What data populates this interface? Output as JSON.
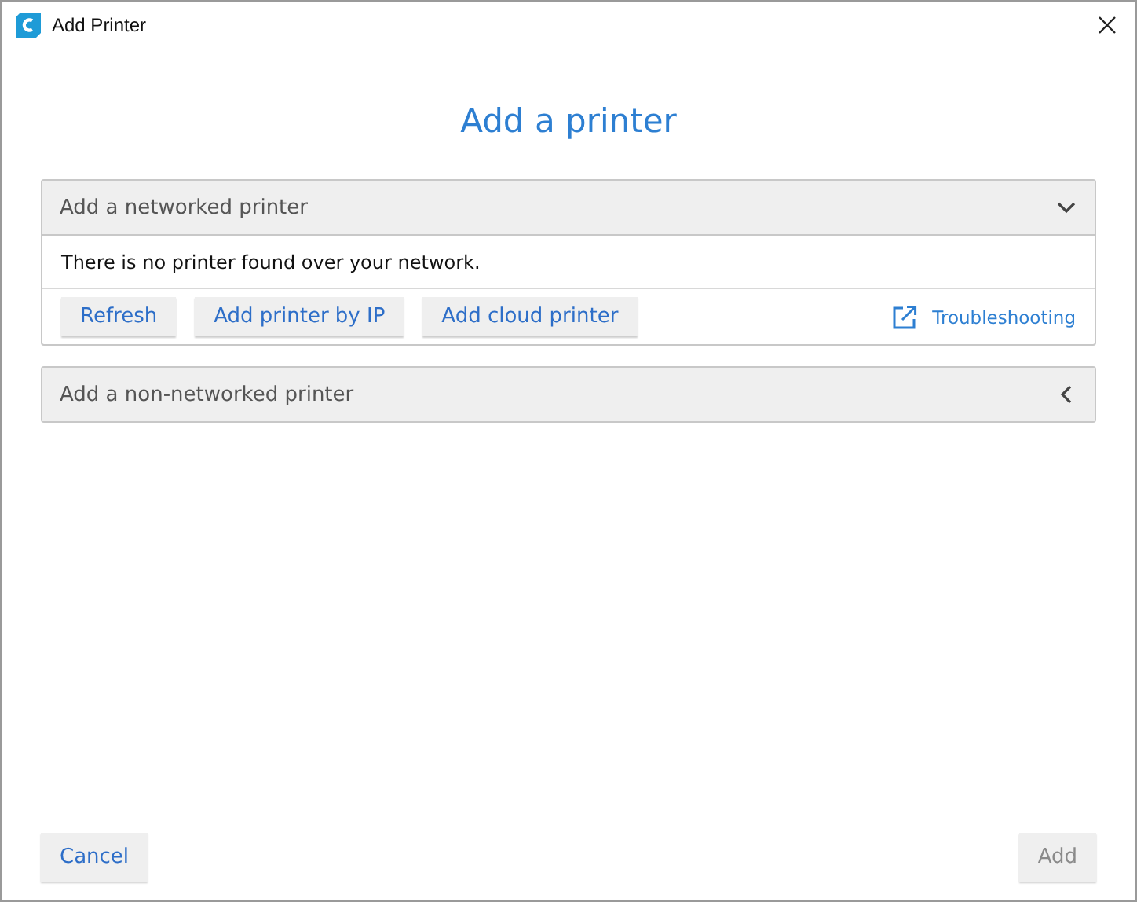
{
  "window": {
    "title": "Add Printer"
  },
  "heading": "Add a printer",
  "sections": [
    {
      "title": "Add a networked printer",
      "expanded": true,
      "message": "There is no printer found over your network.",
      "buttons": [
        "Refresh",
        "Add printer by IP",
        "Add cloud printer"
      ],
      "link": "Troubleshooting"
    },
    {
      "title": "Add a non-networked printer",
      "expanded": false
    }
  ],
  "footer_buttons": [
    {
      "label": "Cancel",
      "disabled": false
    },
    {
      "label": "Add",
      "disabled": true
    }
  ]
}
